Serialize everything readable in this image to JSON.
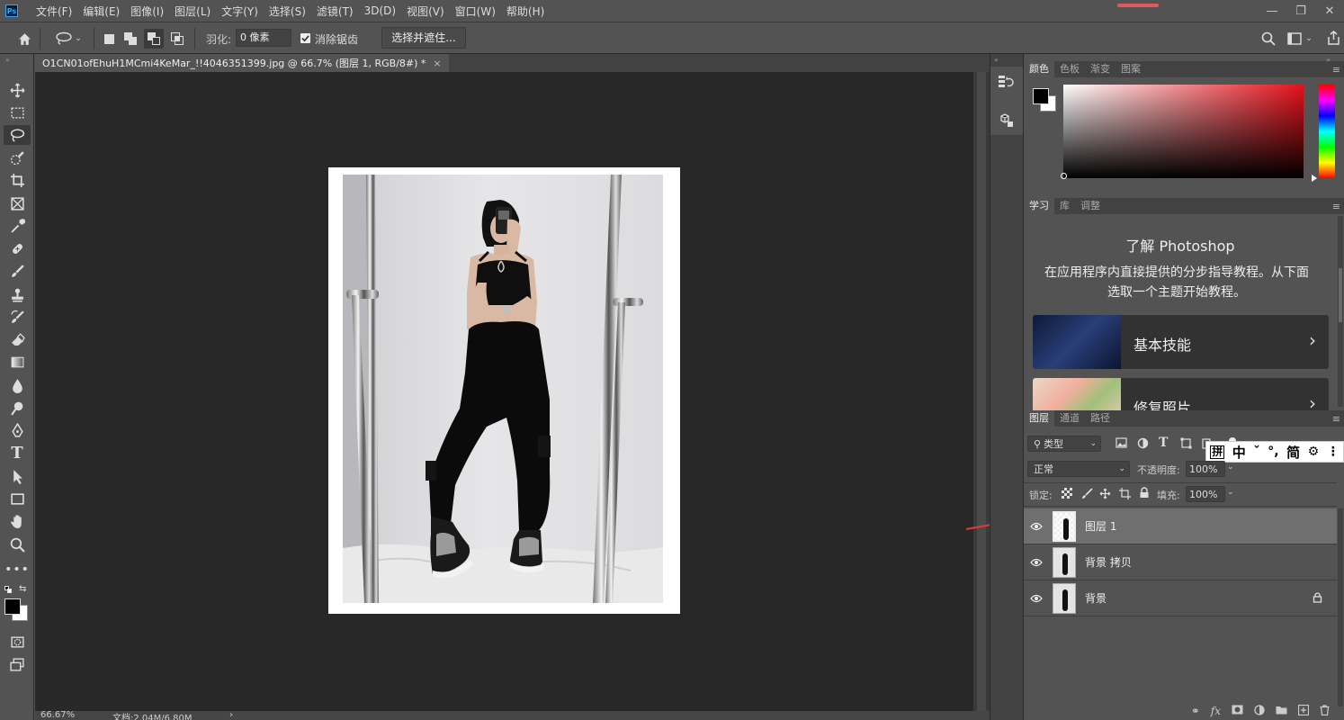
{
  "app": {
    "logo": "Ps"
  },
  "menu": [
    "文件(F)",
    "编辑(E)",
    "图像(I)",
    "图层(L)",
    "文字(Y)",
    "选择(S)",
    "滤镜(T)",
    "3D(D)",
    "视图(V)",
    "窗口(W)",
    "帮助(H)"
  ],
  "window_controls": {
    "minimize": "—",
    "restore": "❐",
    "close": "✕"
  },
  "options": {
    "feather_label": "羽化:",
    "feather_value": "0 像素",
    "antialias_label": "消除锯齿",
    "antialias_checked": true,
    "select_mask_label": "选择并遮住..."
  },
  "document": {
    "tab_title": "O1CN01ofEhuH1MCmi4KeMar_!!4046351399.jpg @ 66.7% (图层 1, RGB/8#) *",
    "close_glyph": "×"
  },
  "status": {
    "zoom": "66.67%",
    "doc_info": "文档:2.04M/6.80M",
    "arrow": "›"
  },
  "color_panel": {
    "tabs": [
      "颜色",
      "色板",
      "渐变",
      "图案"
    ],
    "foreground": "#000000",
    "background": "#ffffff"
  },
  "learn_panel": {
    "tabs": [
      "学习",
      "库",
      "调整"
    ],
    "title": "了解 Photoshop",
    "description": "在应用程序内直接提供的分步指导教程。从下面选取一个主题开始教程。",
    "cards": [
      {
        "label": "基本技能"
      },
      {
        "label": "修复照片"
      }
    ]
  },
  "layers_panel": {
    "tabs": [
      "图层",
      "通道",
      "路径"
    ],
    "filter_label": "类型",
    "blend_mode": "正常",
    "opacity_label": "不透明度:",
    "opacity_value": "100%",
    "lock_label": "锁定:",
    "fill_label": "填充:",
    "fill_value": "100%",
    "layers": [
      {
        "name": "图层 1",
        "selected": true,
        "locked": false
      },
      {
        "name": "背景 拷贝",
        "selected": false,
        "locked": false
      },
      {
        "name": "背景",
        "selected": false,
        "locked": true
      }
    ]
  },
  "ime_bar": {
    "items": [
      "拼",
      "中",
      "ˇ",
      "°,",
      "简",
      "⚙",
      "⋮"
    ]
  },
  "colors": {
    "annotation_arrow": "#e03a3a"
  }
}
